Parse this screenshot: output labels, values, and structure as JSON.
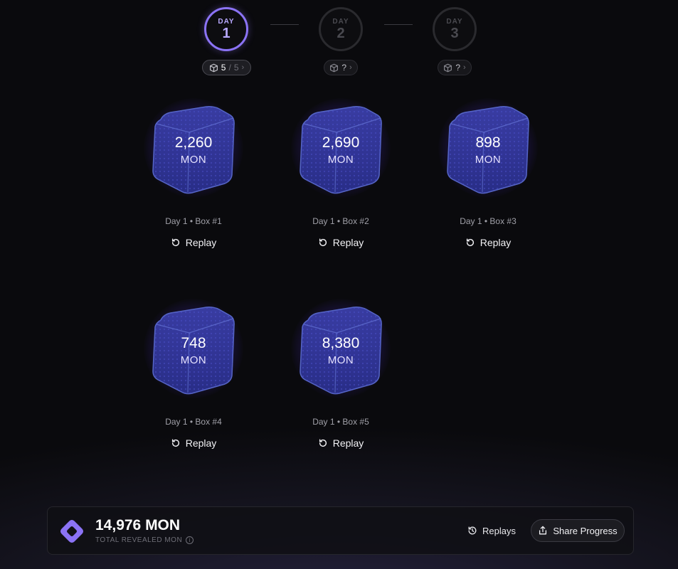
{
  "days": [
    {
      "word": "DAY",
      "number": "1",
      "active": true,
      "count": "5",
      "sep": "/",
      "total": "5"
    },
    {
      "word": "DAY",
      "number": "2",
      "active": false,
      "count": "?"
    },
    {
      "word": "DAY",
      "number": "3",
      "active": false,
      "count": "?"
    }
  ],
  "boxes": [
    {
      "value": "2,260",
      "unit": "MON",
      "label": "Day 1 • Box #1",
      "replay": "Replay"
    },
    {
      "value": "2,690",
      "unit": "MON",
      "label": "Day 1 • Box #2",
      "replay": "Replay"
    },
    {
      "value": "898",
      "unit": "MON",
      "label": "Day 1 • Box #3",
      "replay": "Replay"
    },
    {
      "value": "748",
      "unit": "MON",
      "label": "Day 1 • Box #4",
      "replay": "Replay"
    },
    {
      "value": "8,380",
      "unit": "MON",
      "label": "Day 1 • Box #5",
      "replay": "Replay"
    }
  ],
  "footer": {
    "total_value": "14,976 MON",
    "total_label": "TOTAL REVEALED MON",
    "info_glyph": "i",
    "replays_label": "Replays",
    "share_label": "Share Progress"
  },
  "colors": {
    "accent": "#8b73f5",
    "background": "#0a0a0d",
    "box_glow": "#6240eb"
  },
  "icons": [
    "cube-icon",
    "chevron-right-icon",
    "replay-icon",
    "history-icon",
    "share-icon",
    "info-icon",
    "logo-icon"
  ]
}
